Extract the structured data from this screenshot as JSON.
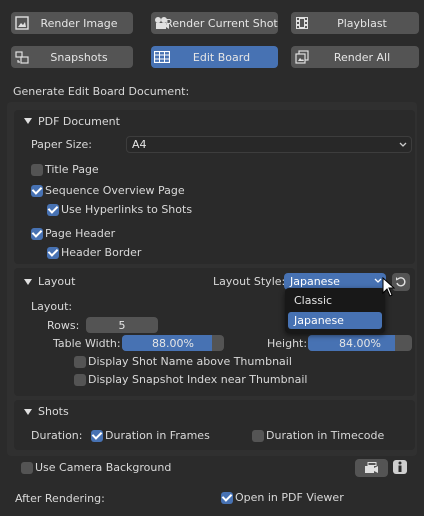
{
  "toolbar": {
    "render_image": "Render Image",
    "render_current_shot": "Render Current Shot",
    "playblast": "Playblast",
    "snapshots": "Snapshots",
    "edit_board": "Edit Board",
    "render_all": "Render All"
  },
  "description": "Generate Edit Board Document:",
  "pdf": {
    "header": "PDF Document",
    "paper_size_label": "Paper Size:",
    "paper_size_value": "A4",
    "title_page": "Title Page",
    "title_page_checked": false,
    "sequence_overview": "Sequence Overview Page",
    "sequence_overview_checked": true,
    "use_hyperlinks": "Use Hyperlinks to Shots",
    "use_hyperlinks_checked": true,
    "page_header": "Page Header",
    "page_header_checked": true,
    "header_border": "Header Border",
    "header_border_checked": true
  },
  "layout": {
    "header": "Layout",
    "layout_style_label": "Layout Style:",
    "layout_style_value": "Japanese",
    "layout_style_options": [
      "Classic",
      "Japanese"
    ],
    "layout_label": "Layout:",
    "rows_label": "Rows:",
    "rows_value": "5",
    "table_width_label": "Table Width:",
    "table_width_value": "88.00%",
    "table_width_fraction": 0.88,
    "height_label": "Height:",
    "height_value": "84.00%",
    "height_fraction": 0.84,
    "display_shot_name": "Display Shot Name above Thumbnail",
    "display_shot_name_checked": false,
    "display_snapshot_index": "Display Snapshot Index near Thumbnail",
    "display_snapshot_index_checked": false
  },
  "shots": {
    "header": "Shots",
    "duration_label": "Duration:",
    "duration_in_frames": "Duration in Frames",
    "duration_in_frames_checked": true,
    "duration_in_timecode": "Duration in Timecode",
    "duration_in_timecode_checked": false
  },
  "camera_background": {
    "label": "Use Camera Background",
    "checked": false
  },
  "after_rendering": {
    "label": "After Rendering:",
    "open_pdf": "Open in PDF Viewer",
    "open_pdf_checked": true
  },
  "colors": {
    "accent": "#4772b3",
    "button": "#545454",
    "background": "#2b2b2b",
    "panel": "#303030"
  },
  "icons": [
    "image-icon",
    "camera-icon",
    "film-icon",
    "snapshot-icon",
    "grid-icon",
    "render-all-icon",
    "reset-icon",
    "camera-bg-icon",
    "info-icon",
    "chevron-down-icon",
    "mouse-cursor-icon"
  ]
}
